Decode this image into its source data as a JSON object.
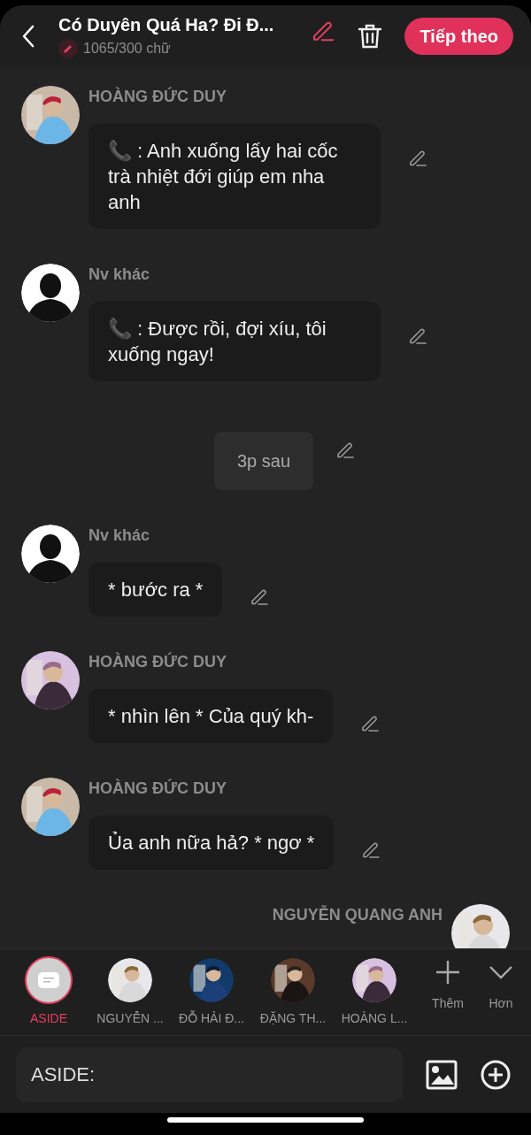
{
  "header": {
    "title": "Có Duyên Quá Ha? Đi Đ...",
    "word_count": "1065/300 chữ",
    "next_button": "Tiếp theo"
  },
  "messages": [
    {
      "kind": "message",
      "name": "HOÀNG ĐỨC DUY",
      "text": "📞 : Anh xuống lấy hai cốc trà nhiệt đới giúp em nha anh"
    },
    {
      "kind": "message",
      "name": "Nv khác",
      "avatar": {
        "kind": "silhouette"
      },
      "text": "📞 : Được rồi, đợi xíu, tôi xuống ngay!"
    },
    {
      "kind": "narration",
      "text": "3p sau"
    },
    {
      "kind": "message",
      "name": "Nv khác",
      "avatar": {
        "kind": "silhouette"
      },
      "text": "* bước ra *"
    },
    {
      "kind": "message",
      "name": "HOÀNG ĐỨC DUY",
      "text": "* nhìn lên * Của quý kh-"
    },
    {
      "kind": "message",
      "name": "HOÀNG ĐỨC DUY",
      "text": "Ủa anh nữa hả? * ngơ *"
    },
    {
      "kind": "message_right",
      "name": "NGUYỄN QUANG ANH"
    }
  ],
  "characters": [
    {
      "kind": "aside",
      "label": "ASIDE",
      "selected": true
    },
    {
      "label": "NGUYỄN ...",
      "selected": false
    },
    {
      "label": "ĐỖ HẢI Đ...",
      "selected": false
    },
    {
      "label": "ĐẶNG TH...",
      "selected": false
    },
    {
      "label": "HOÀNG L...",
      "selected": false
    }
  ],
  "add_label": "Thêm",
  "more_label": "Hơn",
  "input": {
    "placeholder": "ASIDE:"
  }
}
